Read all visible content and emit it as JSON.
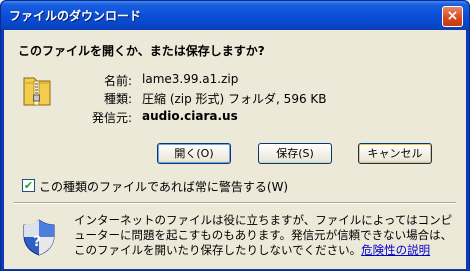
{
  "window": {
    "title": "ファイルのダウンロード",
    "close_label": "×"
  },
  "dialog": {
    "heading": "このファイルを開くか、または保存しますか?",
    "file_icon": "zip-file-icon",
    "fields": [
      {
        "label": "名前:",
        "value": "lame3.99.a1.zip"
      },
      {
        "label": "種類:",
        "value": "圧縮 (zip 形式) フォルダ, 596 KB"
      },
      {
        "label": "発信元:",
        "value": "audio.ciara.us"
      }
    ],
    "buttons": {
      "open": "開く(O)",
      "save": "保存(S)",
      "cancel": "キャンセル"
    },
    "checkbox": {
      "label": "この種類のファイルであれば常に警告する(W)",
      "checked": true
    },
    "warning": {
      "icon": "security-shield-icon",
      "text": "インターネットのファイルは役に立ちますが、ファイルによってはコンピューターに問題を起こすものもあります。発信元が信頼できない場合は、このファイルを開いたり保存したりしないでください。",
      "link": "危険性の説明"
    }
  },
  "colors": {
    "titlebar": "#0a4fd6",
    "client_bg": "#ece9d8",
    "link": "#0000cc"
  }
}
